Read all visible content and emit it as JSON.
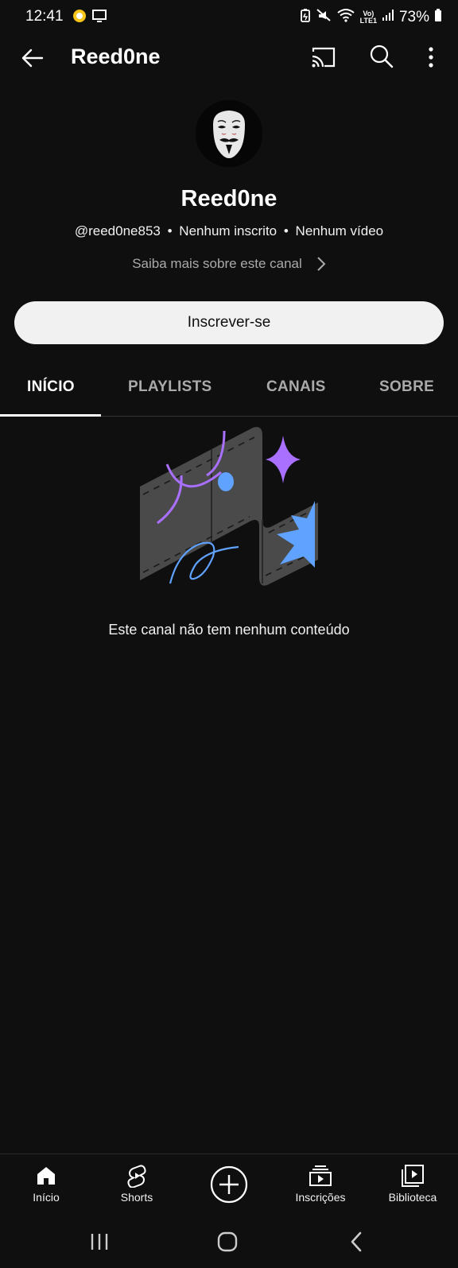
{
  "status_bar": {
    "time": "12:41",
    "network": "LTE1",
    "battery": "73%",
    "icons": [
      "notification-icon",
      "screen-cast-icon",
      "battery-saver-icon",
      "mute-icon",
      "wifi-icon",
      "volte-icon",
      "signal-icon",
      "battery-icon"
    ]
  },
  "app_bar": {
    "title": "Reed0ne"
  },
  "channel": {
    "name": "Reed0ne",
    "handle": "@reed0ne853",
    "subscribers": "Nenhum inscrito",
    "videos": "Nenhum vídeo",
    "separator": "•",
    "more_about": "Saiba mais sobre este canal",
    "subscribe_label": "Inscrever-se"
  },
  "tabs": [
    {
      "label": "INÍCIO",
      "active": true
    },
    {
      "label": "PLAYLISTS",
      "active": false
    },
    {
      "label": "CANAIS",
      "active": false
    },
    {
      "label": "SOBRE",
      "active": false
    }
  ],
  "empty_state": {
    "message": "Este canal não tem nenhum conteúdo"
  },
  "bottom_nav": [
    {
      "label": "Início",
      "icon": "home-icon"
    },
    {
      "label": "Shorts",
      "icon": "shorts-icon"
    },
    {
      "label": "",
      "icon": "create-icon"
    },
    {
      "label": "Inscrições",
      "icon": "subscriptions-icon"
    },
    {
      "label": "Biblioteca",
      "icon": "library-icon"
    }
  ],
  "colors": {
    "background": "#0f0f0f",
    "text_primary": "#f1f1f1",
    "text_secondary": "#aaaaaa",
    "button_bg": "#f1f1f1",
    "illustration_purple": "#a970ff",
    "illustration_blue": "#5fa2ff"
  }
}
